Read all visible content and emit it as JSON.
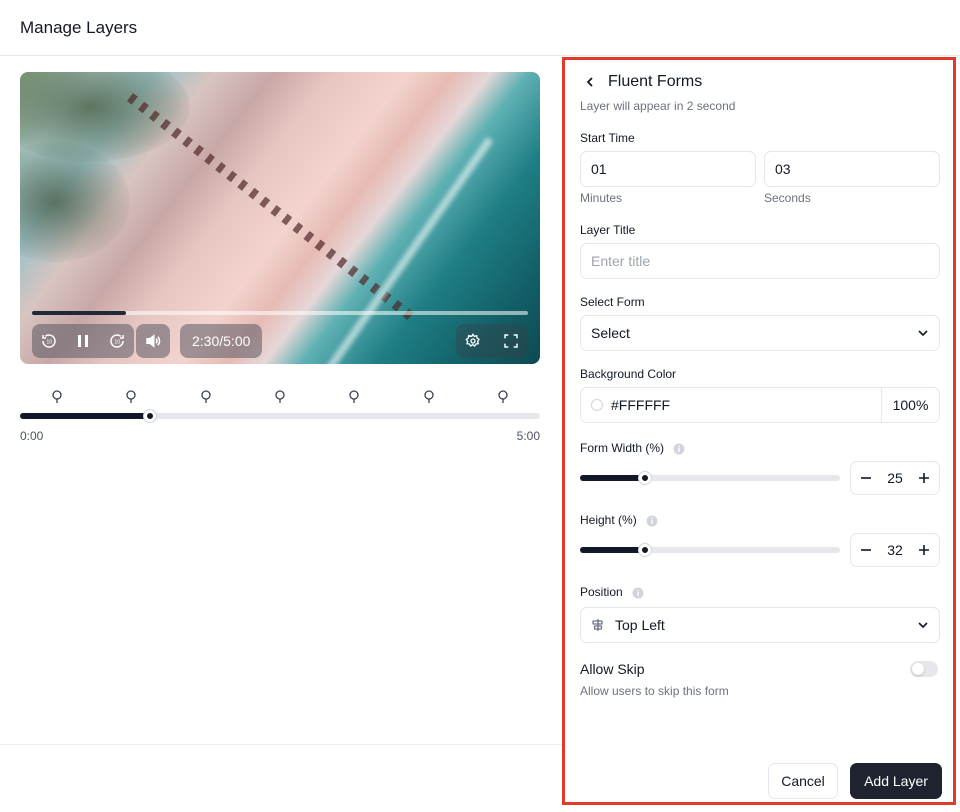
{
  "header": {
    "title": "Manage Layers"
  },
  "player": {
    "time_display": "2:30/5:00",
    "progress_fraction": 0.19
  },
  "timeline": {
    "start_label": "0:00",
    "end_label": "5:00",
    "position_fraction": 0.25,
    "marker_count": 7
  },
  "panel": {
    "title": "Fluent Forms",
    "subtitle": "Layer will appear in 2 second",
    "start_time": {
      "label": "Start Time",
      "minutes_value": "01",
      "minutes_hint": "Minutes",
      "seconds_value": "03",
      "seconds_hint": "Seconds"
    },
    "layer_title": {
      "label": "Layer Title",
      "placeholder": "Enter title"
    },
    "select_form": {
      "label": "Select Form",
      "placeholder": "Select"
    },
    "background_color": {
      "label": "Background Color",
      "value": "#FFFFFF",
      "opacity": "100%"
    },
    "form_width": {
      "label": "Form Width (%)",
      "value": "25",
      "fraction": 0.25
    },
    "height": {
      "label": "Height (%)",
      "value": "32",
      "fraction": 0.25
    },
    "position": {
      "label": "Position",
      "value": "Top Left"
    },
    "allow_skip": {
      "label": "Allow Skip",
      "description": "Allow users to skip this form",
      "enabled": false
    },
    "buttons": {
      "cancel": "Cancel",
      "add": "Add Layer"
    }
  },
  "colors": {
    "accent": "#1f2330",
    "highlight_border": "#e23a2a"
  }
}
